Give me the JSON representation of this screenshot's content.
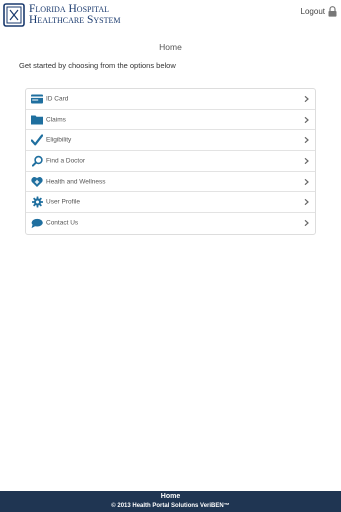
{
  "header": {
    "logo_line1": "Florida Hospital",
    "logo_line2": "Healthcare System",
    "logout_label": "Logout"
  },
  "main": {
    "title": "Home",
    "intro": "Get started by choosing from the options below",
    "menu": [
      {
        "label": "ID Card",
        "icon": "id-card-icon"
      },
      {
        "label": "Claims",
        "icon": "folder-icon"
      },
      {
        "label": "Eligibility",
        "icon": "checkmark-icon"
      },
      {
        "label": "Find a Doctor",
        "icon": "search-icon"
      },
      {
        "label": "Health and Wellness",
        "icon": "heart-plus-icon"
      },
      {
        "label": "User Profile",
        "icon": "gear-icon"
      },
      {
        "label": "Contact Us",
        "icon": "speech-bubble-icon"
      }
    ]
  },
  "footer": {
    "home_label": "Home",
    "copyright": "© 2013 Health Portal Solutions VeriBEN™"
  },
  "colors": {
    "icon_blue": "#1f6f9f",
    "footer_bg": "#1f3552",
    "logo_navy": "#1a3a6e"
  }
}
